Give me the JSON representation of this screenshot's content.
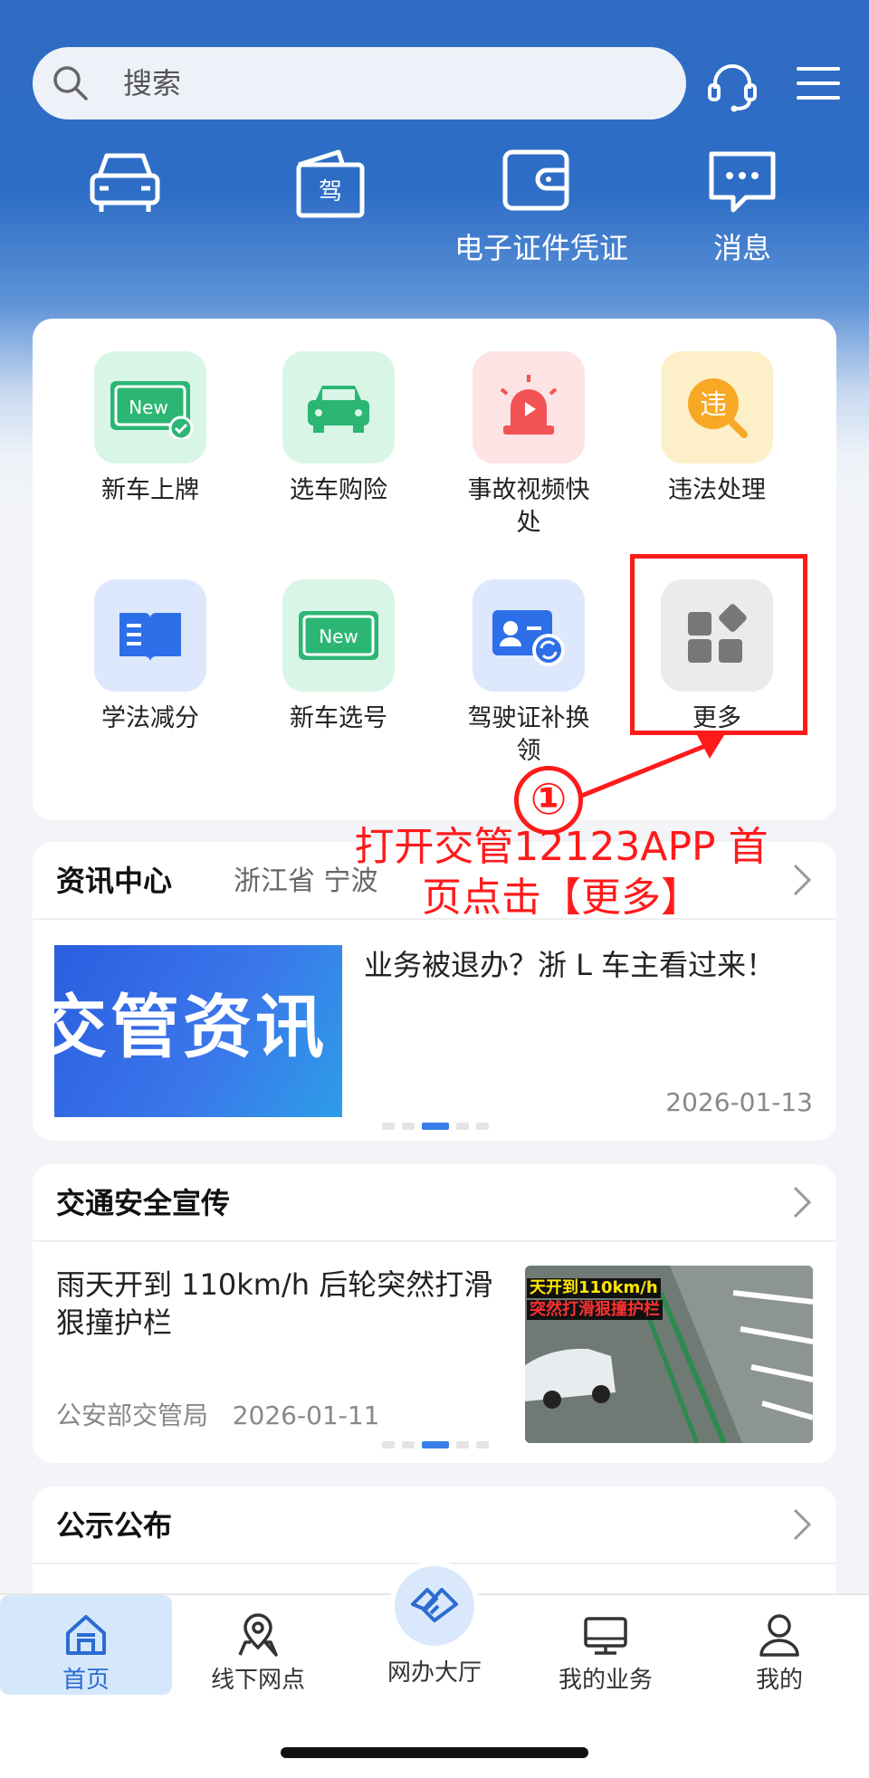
{
  "search": {
    "placeholder": "搜索"
  },
  "quick_actions": [
    {
      "icon": "car-icon",
      "label": ""
    },
    {
      "icon": "license-icon",
      "label": "",
      "badge": "驾"
    },
    {
      "icon": "wallet-icon",
      "label": "电子证件凭证"
    },
    {
      "icon": "message-icon",
      "label": "消息"
    }
  ],
  "services": [
    {
      "label": "新车上牌",
      "icon": "new-plate-icon",
      "badge": "New"
    },
    {
      "label": "选车购险",
      "icon": "car-insurance-icon"
    },
    {
      "label": "事故视频快处",
      "icon": "alarm-light-icon"
    },
    {
      "label": "违法处理",
      "icon": "violation-icon",
      "badge": "违"
    },
    {
      "label": "学法减分",
      "icon": "book-icon"
    },
    {
      "label": "新车选号",
      "icon": "new-number-icon",
      "badge": "New"
    },
    {
      "label": "驾驶证补换领",
      "icon": "license-replace-icon"
    },
    {
      "label": "更多",
      "icon": "more-grid-icon"
    }
  ],
  "annotation": {
    "step": "①",
    "text": "打开交管12123APP 首页点击【更多】",
    "color": "#ff1a1a"
  },
  "news": {
    "title": "资讯中心",
    "region": "浙江省 宁波",
    "image_text": "交管资讯",
    "headline": "业务被退办？浙 L 车主看过来！",
    "date": "2026-01-13"
  },
  "safety": {
    "title": "交通安全宣传",
    "headline": "雨天开到 110km/h 后轮突然打滑狠撞护栏",
    "source": "公安部交管局",
    "date": "2026-01-11",
    "img_caption_1": "天开到110km/h",
    "img_caption_2": "突然打滑狠撞护栏"
  },
  "notice": {
    "title": "公示公布"
  },
  "tabs": [
    {
      "label": "首页",
      "icon": "home-icon",
      "active": true
    },
    {
      "label": "线下网点",
      "icon": "location-icon"
    },
    {
      "label": "网办大厅",
      "icon": "handshake-icon"
    },
    {
      "label": "我的业务",
      "icon": "monitor-icon"
    },
    {
      "label": "我的",
      "icon": "user-icon"
    }
  ],
  "colors": {
    "brand": "#2f6cc4",
    "accent": "#3a7de9"
  }
}
